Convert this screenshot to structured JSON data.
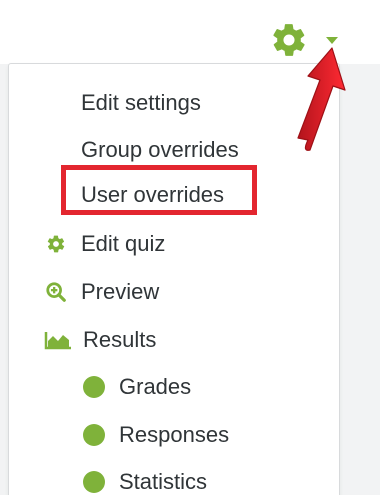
{
  "menu": {
    "items": [
      {
        "label": "Edit settings",
        "icon": null
      },
      {
        "label": "Group overrides",
        "icon": null
      },
      {
        "label": "User overrides",
        "icon": null,
        "highlighted": true
      },
      {
        "label": "Edit quiz",
        "icon": "gear-icon"
      },
      {
        "label": "Preview",
        "icon": "magnifier-plus-icon"
      },
      {
        "label": "Results",
        "icon": "area-chart-icon"
      },
      {
        "label": "Grades",
        "icon": "green-dot-icon"
      },
      {
        "label": "Responses",
        "icon": "green-dot-icon"
      },
      {
        "label": "Statistics",
        "icon": "green-dot-icon"
      }
    ]
  },
  "colors": {
    "accent_green": "#7fb23a",
    "annotation_red": "#e3262f",
    "text": "#303538"
  },
  "toolbar": {
    "gear_icon": "gear-icon",
    "caret_icon": "chevron-down-icon"
  }
}
